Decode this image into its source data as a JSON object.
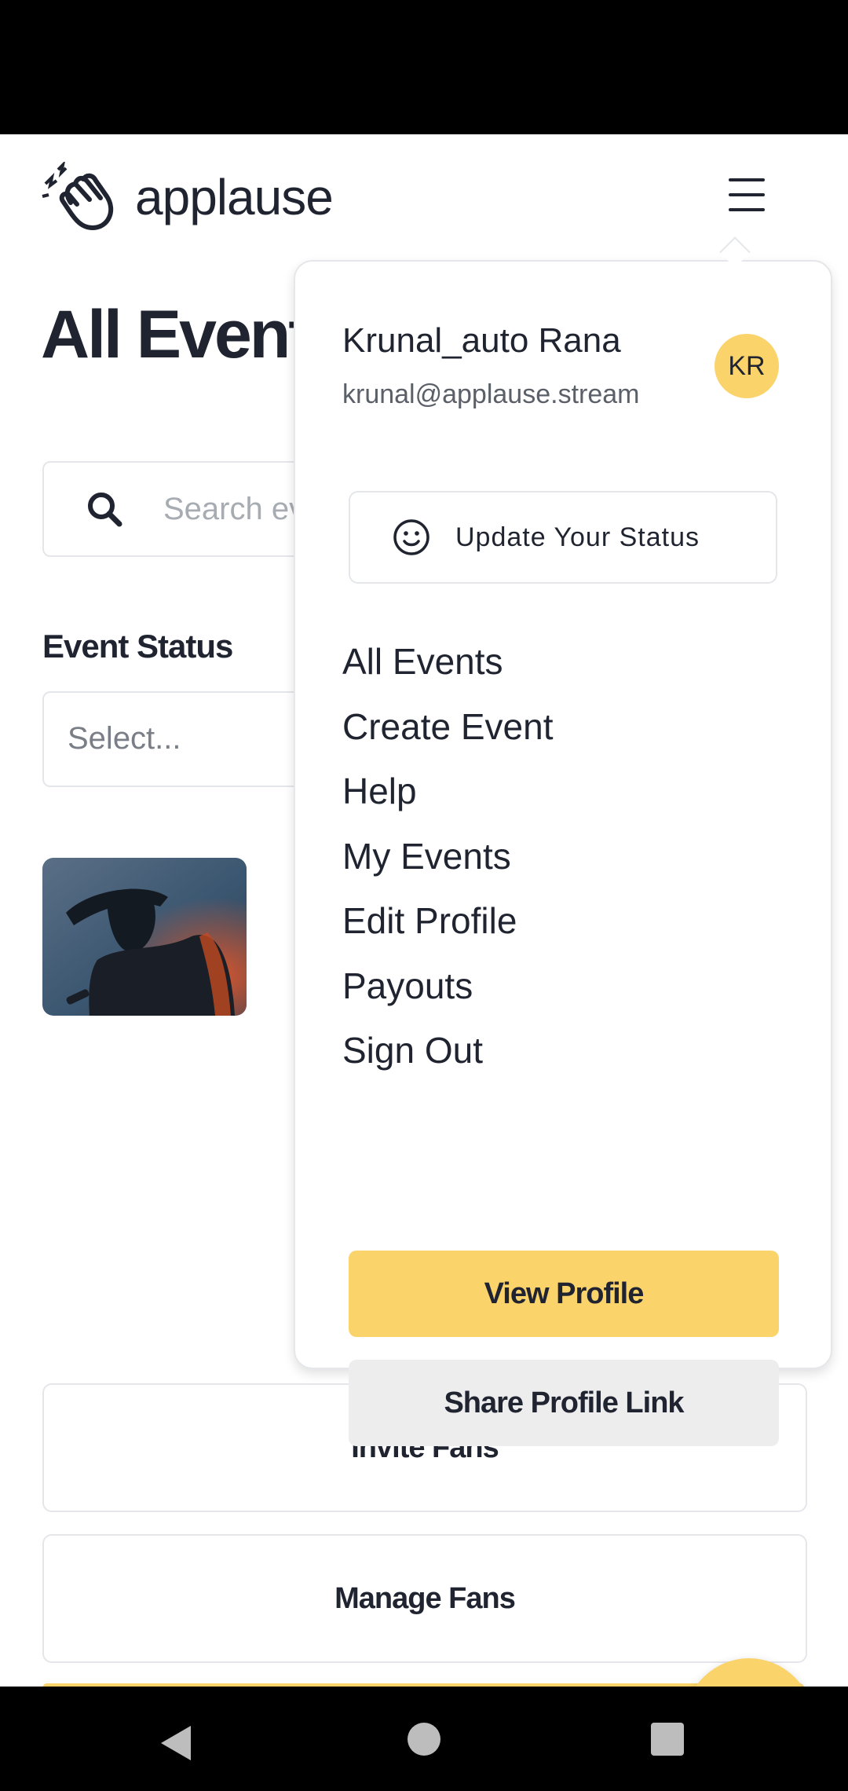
{
  "header": {
    "logo_text": "applause",
    "menu_icon": "hamburger-icon"
  },
  "page": {
    "title": "All Events",
    "search": {
      "placeholder": "Search events"
    },
    "event_status": {
      "label": "Event Status",
      "placeholder": "Select..."
    },
    "buttons": {
      "invite_fans": "Invite Fans",
      "manage_fans": "Manage Fans"
    }
  },
  "menu": {
    "user_name": "Krunal_auto Rana",
    "user_email": "krunal@applause.stream",
    "avatar_initials": "KR",
    "update_status": "Update Your Status",
    "items": [
      "All Events",
      "Create Event",
      "Help",
      "My Events",
      "Edit Profile",
      "Payouts",
      "Sign Out"
    ],
    "view_profile": "View Profile",
    "share_profile_link": "Share Profile Link"
  },
  "colors": {
    "accent": "#fad36b",
    "text": "#1f2430",
    "chat_icon": "#2b3e52"
  }
}
